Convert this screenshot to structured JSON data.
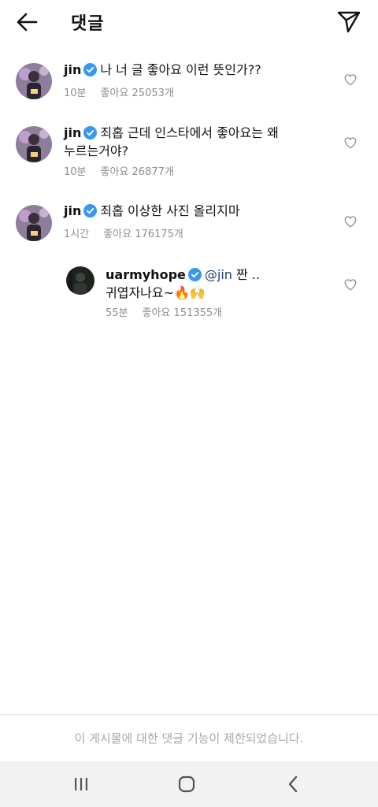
{
  "header": {
    "title": "댓글"
  },
  "comments": [
    {
      "username": "jin",
      "text": "나 너 글 좋아요 이런 뜻인가??",
      "time": "10분",
      "likes": "좋아요 25053개"
    },
    {
      "username": "jin",
      "text_line1": "죄홉 근데 인스타에서 좋아요는 왜",
      "text_line2": "누르는거야?",
      "time": "10분",
      "likes": "좋아요 26877개"
    },
    {
      "username": "jin",
      "text": "죄홉 이상한 사진 올리지마",
      "time": "1시간",
      "likes": "좋아요 176175개"
    }
  ],
  "reply": {
    "username": "uarmyhope",
    "mention": "@jin",
    "text_line1_rest": " 짠 ..",
    "text_line2": "귀엽자나요~🔥🙌",
    "time": "55분",
    "likes": "좋아요 151355개"
  },
  "footer": {
    "restricted_text": "이 게시물에 대한 댓글 기능이 제한되었습니다."
  },
  "colors": {
    "verified_blue": "#3897f0",
    "meta_gray": "#8e8e8e",
    "mention_navy": "#1f3f73"
  }
}
